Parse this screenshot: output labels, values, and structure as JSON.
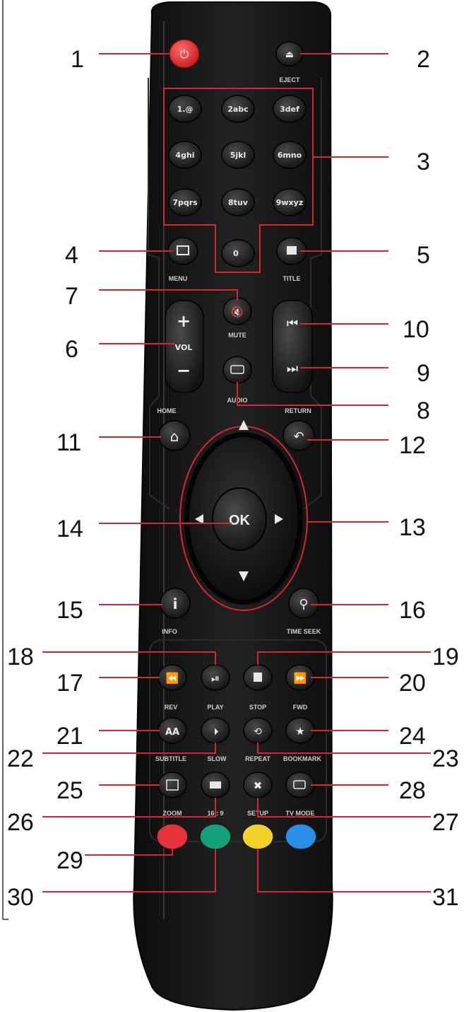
{
  "figure": {
    "callout_color": "#d8262e",
    "remote_body_color": "#171717"
  },
  "button_labels": {
    "eject": "EJECT",
    "menu": "MENU",
    "title": "TITLE",
    "mute": "MUTE",
    "audio": "AUDIO",
    "vol": "VOL",
    "home": "HOME",
    "return": "RETURN",
    "ok": "OK",
    "info": "INFO",
    "time_seek": "TIME SEEK",
    "rev": "REV",
    "play": "PLAY",
    "stop": "STOP",
    "fwd": "FWD",
    "subtitle": "SUBTITLE",
    "slow": "SLOW",
    "repeat": "REPEAT",
    "bookmark": "BOOKMARK",
    "zoom": "ZOOM",
    "aspect": "16 : 9",
    "setup": "SETUP",
    "tv_mode": "TV MODE"
  },
  "numeric_keys": [
    "1.@",
    "2abc",
    "3def",
    "4ghi",
    "5jkl",
    "6mno",
    "7pqrs",
    "8tuv",
    "9wxyz",
    "0"
  ],
  "color_keys": {
    "red": "#e8323a",
    "green": "#15a07a",
    "yellow": "#f2d22a",
    "blue": "#2a8fe8"
  },
  "callouts": [
    "1",
    "2",
    "3",
    "4",
    "5",
    "6",
    "7",
    "8",
    "9",
    "10",
    "11",
    "12",
    "13",
    "14",
    "15",
    "16",
    "17",
    "18",
    "19",
    "20",
    "21",
    "22",
    "23",
    "24",
    "25",
    "26",
    "27",
    "28",
    "29",
    "30",
    "31"
  ]
}
